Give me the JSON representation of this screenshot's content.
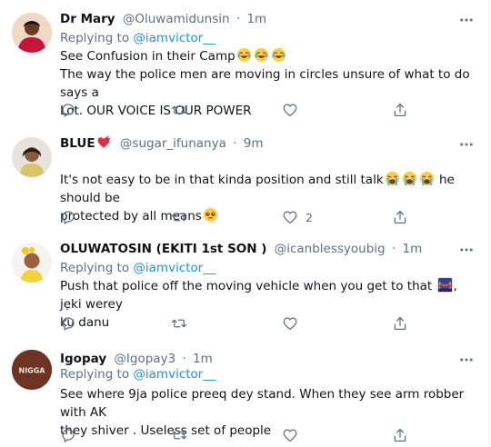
{
  "tweets": [
    {
      "name": "Dr Mary",
      "handle": "@Oluwamidunsin",
      "dot": "·",
      "time": "1m",
      "replying_prefix": "Replying to",
      "replying_to": "@iamvictor__",
      "line1": "See Confusion in their Camp",
      "line1_emojis": [
        "joy-emoji",
        "joy-emoji",
        "joy-emoji"
      ],
      "line2": "The way the police men are moving in circles unsure of what to do says a",
      "line3": "Lot. OUR VOICE IS OUR POWER",
      "like_count": ""
    },
    {
      "name": "BLUE",
      "name_emoji": "heartbeat-emoji",
      "handle": "@sugar_ifunanya",
      "dot": "·",
      "time": "9m",
      "line1": "It's not easy to be in that kinda position and still talk",
      "line1_emojis": [
        "crying-emoji",
        "crying-emoji",
        "crying-emoji"
      ],
      "line1_tail": "he should be",
      "line2": "protected by all means",
      "line2_emoji": "pleading-emoji",
      "like_count": "2"
    },
    {
      "name": "OLUWATOSIN (EKITI 1st SON )",
      "handle": "@icanblessyoubig",
      "dot": "·",
      "time": "1m",
      "replying_prefix": "Replying to",
      "replying_to": "@iamvictor__",
      "line1_a": "Push that police off the moving vehicle when you get to that",
      "line1_emoji": "bridge-at-night-emoji",
      "line1_b": ", jẹki werey",
      "line2": "ku danu",
      "like_count": ""
    },
    {
      "name": "Igopay",
      "handle": "@Igopay3",
      "dot": "·",
      "time": "1m",
      "avatar_text": "NIGGA",
      "replying_prefix": "Replying to",
      "replying_to": "@iamvictor__",
      "line1": "See where 9ja police preeq dey stand. When they see arm robber with AK",
      "line2": "they shiver . Useless set of people",
      "like_count": ""
    }
  ],
  "colors": {
    "text": "#0f1419",
    "secondary": "#5b7083",
    "link": "#1b95e0",
    "divider": "#ebeef0"
  },
  "icons": [
    "reply-icon",
    "retweet-icon",
    "like-icon",
    "share-icon",
    "more-icon"
  ]
}
